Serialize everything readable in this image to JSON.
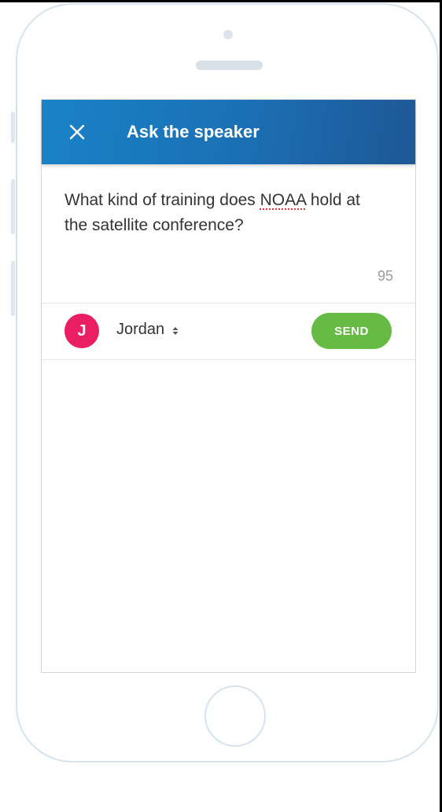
{
  "header": {
    "title": "Ask the speaker",
    "close_icon": "close-icon"
  },
  "question": {
    "before": "What kind of training does ",
    "misspelled": "NOAA",
    "after": " hold at the satellite conference?"
  },
  "char_count": "95",
  "author": {
    "initial": "J",
    "name": "Jordan",
    "avatar_color": "#e91e63",
    "dropdown_icon": "sort-icon"
  },
  "send_label": "SEND",
  "colors": {
    "appbar": "#1b6fb3",
    "send": "#66bb44"
  }
}
